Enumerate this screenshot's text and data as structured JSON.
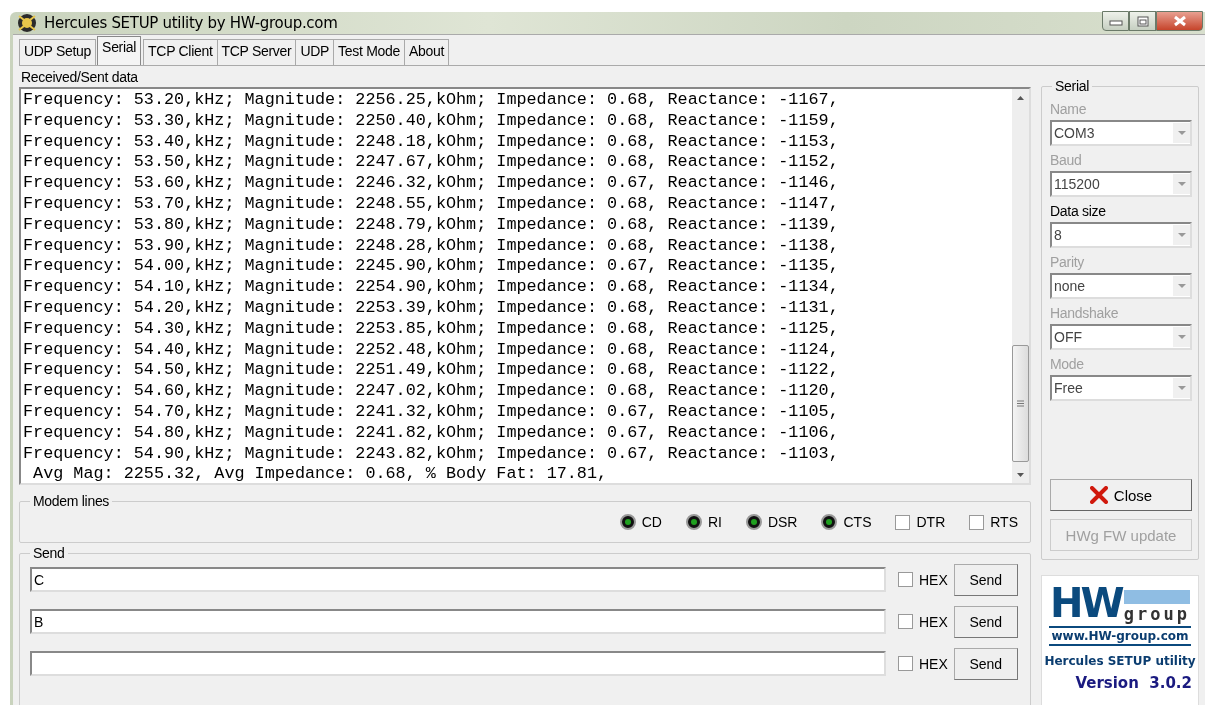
{
  "window": {
    "title": "Hercules SETUP utility by HW-group.com"
  },
  "tabs": [
    {
      "label": "UDP Setup",
      "selected": false
    },
    {
      "label": "Serial",
      "selected": true
    },
    {
      "label": "TCP Client",
      "selected": false
    },
    {
      "label": "TCP Server",
      "selected": false
    },
    {
      "label": "UDP",
      "selected": false
    },
    {
      "label": "Test Mode",
      "selected": false
    },
    {
      "label": "About",
      "selected": false
    }
  ],
  "received": {
    "label": "Received/Sent data",
    "lines": [
      "Frequency: 53.20,kHz; Magnitude: 2256.25,kOhm; Impedance: 0.68, Reactance: -1167,",
      "Frequency: 53.30,kHz; Magnitude: 2250.40,kOhm; Impedance: 0.68, Reactance: -1159,",
      "Frequency: 53.40,kHz; Magnitude: 2248.18,kOhm; Impedance: 0.68, Reactance: -1153,",
      "Frequency: 53.50,kHz; Magnitude: 2247.67,kOhm; Impedance: 0.68, Reactance: -1152,",
      "Frequency: 53.60,kHz; Magnitude: 2246.32,kOhm; Impedance: 0.67, Reactance: -1146,",
      "Frequency: 53.70,kHz; Magnitude: 2248.55,kOhm; Impedance: 0.68, Reactance: -1147,",
      "Frequency: 53.80,kHz; Magnitude: 2248.79,kOhm; Impedance: 0.68, Reactance: -1139,",
      "Frequency: 53.90,kHz; Magnitude: 2248.28,kOhm; Impedance: 0.68, Reactance: -1138,",
      "Frequency: 54.00,kHz; Magnitude: 2245.90,kOhm; Impedance: 0.67, Reactance: -1135,",
      "Frequency: 54.10,kHz; Magnitude: 2254.90,kOhm; Impedance: 0.68, Reactance: -1134,",
      "Frequency: 54.20,kHz; Magnitude: 2253.39,kOhm; Impedance: 0.68, Reactance: -1131,",
      "Frequency: 54.30,kHz; Magnitude: 2253.85,kOhm; Impedance: 0.68, Reactance: -1125,",
      "Frequency: 54.40,kHz; Magnitude: 2252.48,kOhm; Impedance: 0.68, Reactance: -1124,",
      "Frequency: 54.50,kHz; Magnitude: 2251.49,kOhm; Impedance: 0.68, Reactance: -1122,",
      "Frequency: 54.60,kHz; Magnitude: 2247.02,kOhm; Impedance: 0.68, Reactance: -1120,",
      "Frequency: 54.70,kHz; Magnitude: 2241.32,kOhm; Impedance: 0.67, Reactance: -1105,",
      "Frequency: 54.80,kHz; Magnitude: 2241.82,kOhm; Impedance: 0.67, Reactance: -1106,",
      "Frequency: 54.90,kHz; Magnitude: 2243.82,kOhm; Impedance: 0.67, Reactance: -1103,",
      " Avg Mag: 2255.32, Avg Impedance: 0.68, % Body Fat: 17.81,"
    ]
  },
  "modem_lines": {
    "label": "Modem lines",
    "items": [
      {
        "kind": "led",
        "label": "CD",
        "on": true
      },
      {
        "kind": "led",
        "label": "RI",
        "on": true
      },
      {
        "kind": "led",
        "label": "DSR",
        "on": true
      },
      {
        "kind": "led",
        "label": "CTS",
        "on": true
      },
      {
        "kind": "checkbox",
        "label": "DTR",
        "checked": false
      },
      {
        "kind": "checkbox",
        "label": "RTS",
        "checked": false
      }
    ]
  },
  "send": {
    "label": "Send",
    "rows": [
      {
        "value": "C",
        "hex_label": "HEX",
        "hex": false,
        "button": "Send"
      },
      {
        "value": "B",
        "hex_label": "HEX",
        "hex": false,
        "button": "Send"
      },
      {
        "hex_label": "HEX",
        "hex": false,
        "button": "Send"
      }
    ]
  },
  "serial": {
    "label": "Serial",
    "fields": [
      {
        "label": "Name",
        "value": "COM3",
        "disabled": true
      },
      {
        "label": "Baud",
        "value": "115200",
        "disabled": true
      },
      {
        "label": "Data size",
        "value": "8",
        "disabled": false
      },
      {
        "label": "Parity",
        "value": "none",
        "disabled": true
      },
      {
        "label": "Handshake",
        "value": "OFF",
        "disabled": true
      },
      {
        "label": "Mode",
        "value": "Free",
        "disabled": true
      }
    ],
    "buttons": [
      {
        "label": "Close",
        "disabled": false
      },
      {
        "label": "HWg FW update",
        "disabled": true
      }
    ]
  },
  "logo": {
    "mark": "HW",
    "word": "group",
    "url": "www.HW-group.com",
    "product": "Hercules SETUP utility",
    "version": "Version  3.0.2"
  }
}
